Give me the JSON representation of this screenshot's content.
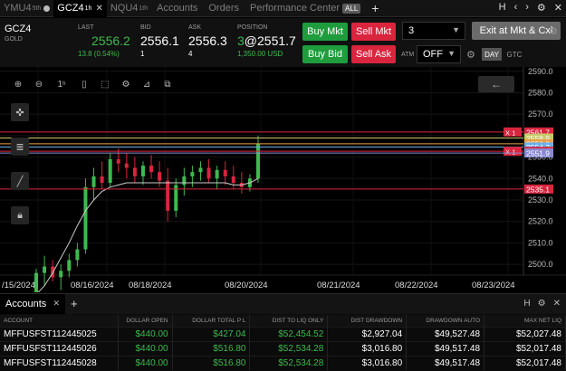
{
  "tabs": [
    {
      "label": "YMU4",
      "sup": "5th",
      "active": false
    },
    {
      "label": "GCZ4",
      "sup": "1h",
      "active": true
    },
    {
      "label": "NQU4",
      "sup": "1th",
      "active": false
    }
  ],
  "menu": [
    "Accounts",
    "Orders",
    "Performance Center"
  ],
  "all_badge": "ALL",
  "quote": {
    "symbol": "GCZ4",
    "desc": "GOLD",
    "last_label": "LAST",
    "last": "2556.2",
    "last_change": "13.8 (0.54%)",
    "bid_label": "BID",
    "bid": "2556.1",
    "bid_size": "1",
    "ask_label": "ASK",
    "ask": "2556.3",
    "ask_size": "4",
    "position_label": "POSITION",
    "position_qty": "3",
    "position_price": "@2551.7",
    "position_pnl": "1,350.00 USD"
  },
  "orders": {
    "buy_mkt": "Buy Mkt",
    "sell_mkt": "Sell Mkt",
    "buy_bid": "Buy Bid",
    "sell_ask": "Sell Ask",
    "qty": "3",
    "exit": "Exit at Mkt & Cxl",
    "atm_label": "ATM",
    "atm_value": "OFF",
    "day": "DAY",
    "gtc": "GTC"
  },
  "chart_data": {
    "type": "candlestick",
    "y_ticks": [
      "2500.0",
      "2510.0",
      "2520.0",
      "2530.0",
      "2540.0",
      "2550.0",
      "2560.0",
      "2570.0",
      "2580.0",
      "2590.0"
    ],
    "x_ticks": [
      "/15/2024",
      "08/16/2024",
      "08/18/2024",
      "08/20/2024",
      "08/21/2024",
      "08/22/2024",
      "08/23/2024"
    ],
    "ylim": [
      2495,
      2592
    ],
    "price_lines": [
      {
        "label": "2561.7",
        "value": 2561.7,
        "color": "#d9253e",
        "tag": "X 1"
      },
      {
        "label": "2558.9",
        "value": 2558.9,
        "color": "#c8c86a"
      },
      {
        "label": "2556.2",
        "value": 2556.2,
        "color": "#e8a048"
      },
      {
        "label": "2554.7",
        "value": 2554.7,
        "color": "#6cb0e8"
      },
      {
        "label": "2552.7",
        "value": 2552.7,
        "color": "#d9253e",
        "tag": "X 1"
      },
      {
        "label": "2551.9",
        "value": 2551.9,
        "color": "#8a8ad0"
      },
      {
        "label": "2535.1",
        "value": 2535.1,
        "color": "#d9253e"
      }
    ],
    "candles": [
      [
        2482,
        2498,
        2478,
        2496
      ],
      [
        2496,
        2504,
        2490,
        2499
      ],
      [
        2499,
        2502,
        2492,
        2494
      ],
      [
        2494,
        2500,
        2488,
        2497
      ],
      [
        2497,
        2505,
        2494,
        2502
      ],
      [
        2502,
        2510,
        2499,
        2507
      ],
      [
        2507,
        2540,
        2505,
        2536
      ],
      [
        2536,
        2545,
        2530,
        2541
      ],
      [
        2541,
        2548,
        2535,
        2538
      ],
      [
        2538,
        2552,
        2536,
        2549
      ],
      [
        2549,
        2554,
        2543,
        2547
      ],
      [
        2547,
        2552,
        2540,
        2545
      ],
      [
        2545,
        2550,
        2538,
        2541
      ],
      [
        2541,
        2548,
        2537,
        2546
      ],
      [
        2546,
        2551,
        2540,
        2543
      ],
      [
        2543,
        2548,
        2536,
        2539
      ],
      [
        2539,
        2545,
        2520,
        2525
      ],
      [
        2525,
        2540,
        2522,
        2537
      ],
      [
        2537,
        2545,
        2532,
        2541
      ],
      [
        2541,
        2546,
        2536,
        2543
      ],
      [
        2543,
        2548,
        2539,
        2545
      ],
      [
        2545,
        2549,
        2538,
        2540
      ],
      [
        2540,
        2546,
        2535,
        2544
      ],
      [
        2544,
        2548,
        2537,
        2541
      ],
      [
        2541,
        2546,
        2535,
        2538
      ],
      [
        2538,
        2543,
        2533,
        2536
      ],
      [
        2536,
        2542,
        2534,
        2540
      ],
      [
        2540,
        2560,
        2538,
        2556.2
      ]
    ],
    "ma_line": [
      2486,
      2490,
      2496,
      2503,
      2510,
      2518,
      2525,
      2530,
      2534,
      2536,
      2537,
      2538,
      2538,
      2538,
      2538,
      2538,
      2538,
      2538,
      2538,
      2538,
      2538,
      2538,
      2538,
      2538,
      2537,
      2537,
      2538,
      2540
    ]
  },
  "accounts": {
    "tab_label": "Accounts",
    "columns": [
      "ACCOUNT",
      "DOLLAR OPEN",
      "DOLLAR TOTAL P L",
      "DIST TO LIQ ONLY",
      "DIST DRAWDOWN",
      "DRAWDOWN AUTO",
      "MAX NET LIQ"
    ],
    "rows": [
      [
        "MFFUSFST112445025",
        "$440.00",
        "$427.04",
        "$52,454.52",
        "$2,927.04",
        "$49,527.48",
        "$52,027.48"
      ],
      [
        "MFFUSFST112445026",
        "$440.00",
        "$516.80",
        "$52,534.28",
        "$3,016.80",
        "$49,517.48",
        "$52,017.48"
      ],
      [
        "MFFUSFST112445028",
        "$440.00",
        "$516.80",
        "$52,534.28",
        "$3,016.80",
        "$49,517.48",
        "$52,017.48"
      ]
    ]
  }
}
